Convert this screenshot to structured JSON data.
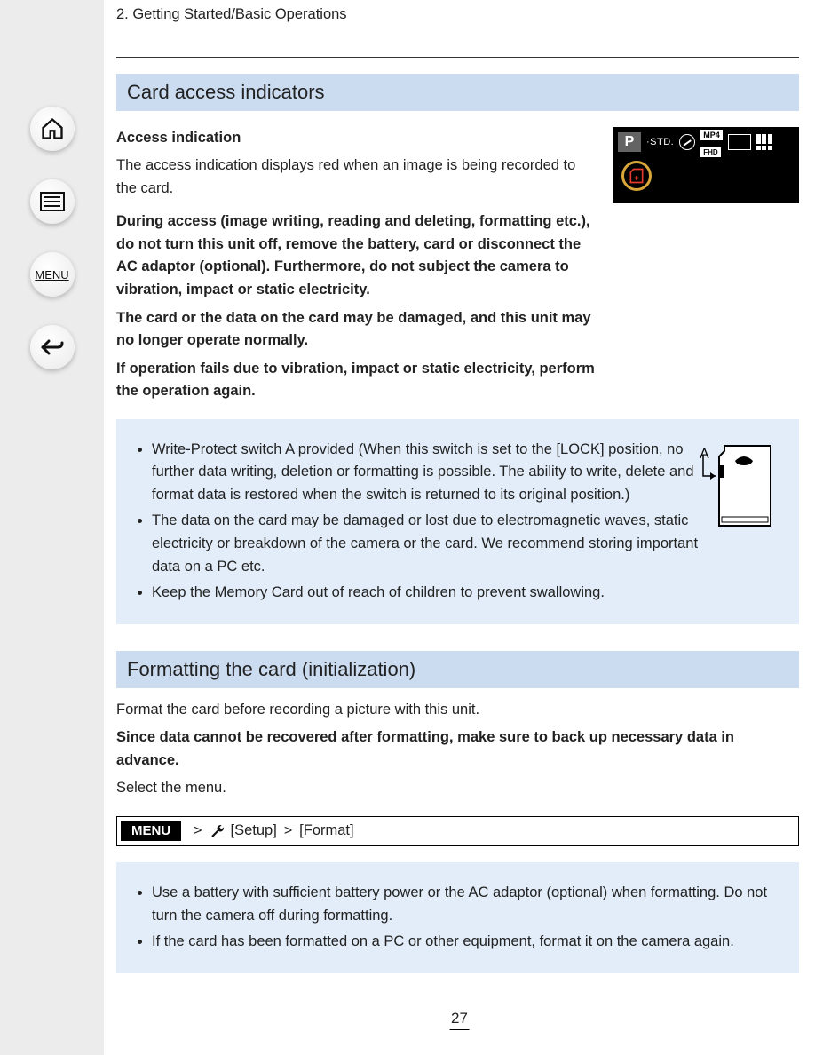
{
  "breadcrumb": "2. Getting Started/Basic Operations",
  "nav": {
    "home_aria": "Home",
    "index_aria": "Index",
    "menu_label": "MENU",
    "back_aria": "Back"
  },
  "section1": {
    "heading": "Card access indicators",
    "section_label": "Access indication",
    "body_1": "The access indication displays red when an image is being recorded to the card.",
    "body_2_a": "During access (image writing, reading and deleting, formatting etc.), do not turn this unit off, remove the battery, card or disconnect the AC adaptor (optional). Furthermore, do not subject the camera to vibration, impact or static electricity.",
    "body_2_b": "The card or the data on the card may be damaged, and this unit may no longer operate normally.",
    "body_2_c": "If operation fails due to vibration, impact or static electricity, perform the operation again.",
    "info_bullet_1": "Write-Protect switch A provided (When this switch is set to the [LOCK] position, no further data writing, deletion or formatting is possible. The ability to write, delete and format data is restored when the switch is returned to its original position.)",
    "info_bullet_2": "The data on the card may be damaged or lost due to electromagnetic waves, static electricity or breakdown of the camera or the card. We recommend storing important data on a PC etc.",
    "info_bullet_3": "Keep the Memory Card out of reach of children to prevent swallowing.",
    "write_protect_label": "A"
  },
  "section2": {
    "heading": "Formatting the card (initialization)",
    "p1": "Format the card before recording a picture with this unit.",
    "p2_strong": "Since data cannot be recovered after formatting, make sure to back up necessary data in advance.",
    "p3": "Select the menu.",
    "menu_chip": "MENU",
    "menu_arrow": ">",
    "menu_setup": "[Setup]",
    "menu_format": "[Format]",
    "info_bullet_1": "Use a battery with sufficient battery power or the AC adaptor (optional) when formatting. Do not turn the camera off during formatting.",
    "info_bullet_2": "If the card has been formatted on a PC or other equipment, format it on the camera again."
  },
  "lcd": {
    "mode": "P",
    "std": "STD.",
    "mp4": "MP4",
    "fhd": "FHD",
    "sd_icon": "sd-card-icon"
  },
  "page_number": "27"
}
